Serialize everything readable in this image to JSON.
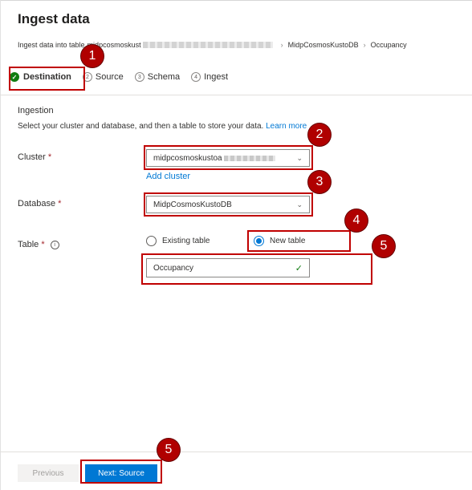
{
  "title": "Ingest data",
  "breadcrumb": {
    "prefix": "Ingest data into table",
    "cluster_partial": "midpcosmoskust",
    "database": "MidpCosmosKustoDB",
    "table": "Occupancy"
  },
  "steps": [
    {
      "label": "Destination",
      "num": "1"
    },
    {
      "label": "Source",
      "num": "2"
    },
    {
      "label": "Schema",
      "num": "3"
    },
    {
      "label": "Ingest",
      "num": "4"
    }
  ],
  "section": {
    "title": "Ingestion",
    "description": "Select your cluster and database, and then a table to store your data.",
    "learn_more": "Learn more"
  },
  "cluster": {
    "label": "Cluster",
    "required": "*",
    "value": "midpcosmoskustoa",
    "add_link": "Add cluster"
  },
  "database": {
    "label": "Database",
    "required": "*",
    "value": "MidpCosmosKustoDB"
  },
  "table": {
    "label": "Table",
    "required": "*",
    "info_icon": "i",
    "option_existing": "Existing table",
    "option_new": "New table",
    "value": "Occupancy",
    "valid_icon": "✓"
  },
  "footer": {
    "previous": "Previous",
    "next": "Next: Source"
  },
  "annotations": {
    "b1": "1",
    "b2": "2",
    "b3": "3",
    "b4": "4",
    "b5a": "5",
    "b5b": "5"
  },
  "colors": {
    "accent": "#0078d4",
    "success": "#107c10",
    "highlight": "#c00000",
    "badge": "#b00000"
  }
}
